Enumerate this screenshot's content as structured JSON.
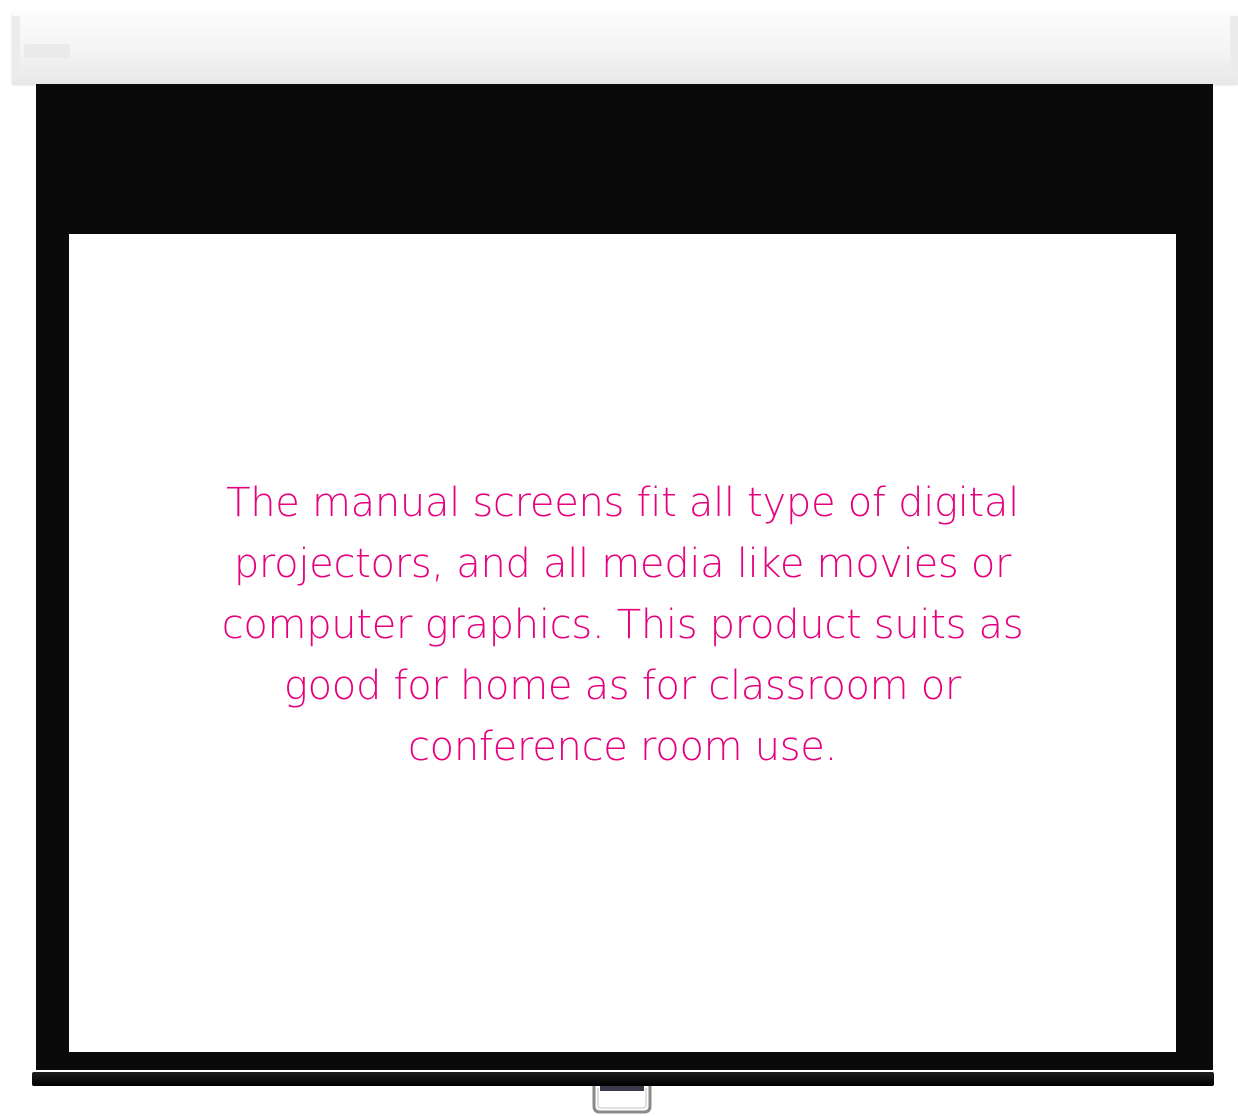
{
  "screen": {
    "caption": "The manual screens fit all type of digital projectors, and all media like movies or computer graphics. This product suits as good for home as for classroom or conference room use."
  },
  "colors": {
    "caption_text": "#e6007e",
    "fabric_border": "#0a0a0a",
    "viewing_surface": "#ffffff",
    "housing": "#f4f4f4"
  }
}
